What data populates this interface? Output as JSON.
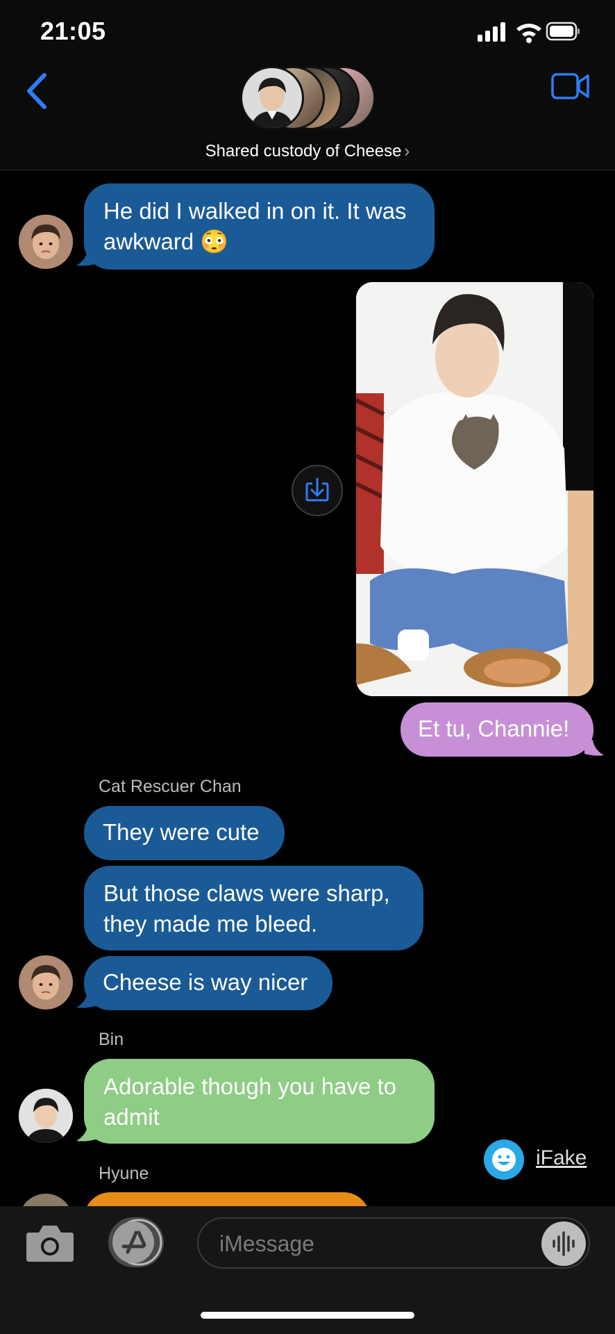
{
  "status": {
    "time": "21:05"
  },
  "header": {
    "group_name": "Shared custody of Cheese",
    "chevron": "›"
  },
  "messages": [
    {
      "text": "He did I walked in on it. It was awkward 😳"
    },
    {
      "text": "Et tu, Channie!"
    },
    {
      "sender": "Cat Rescuer Chan"
    },
    {
      "text": "They were cute"
    },
    {
      "text": "But those claws were sharp, they made me bleed."
    },
    {
      "text": "Cheese is way nicer"
    },
    {
      "sender": "Bin"
    },
    {
      "text": "Adorable though you have to admit"
    },
    {
      "sender": "Hyune"
    }
  ],
  "watermark": {
    "label": "iFake"
  },
  "composer": {
    "placeholder": "iMessage"
  },
  "colors": {
    "blue_bubble": "#1a5a96",
    "green_bubble": "#8fcc86",
    "purple_bubble": "#c790d6",
    "orange_bubble": "#e88c17",
    "accent": "#2f7cf6"
  }
}
